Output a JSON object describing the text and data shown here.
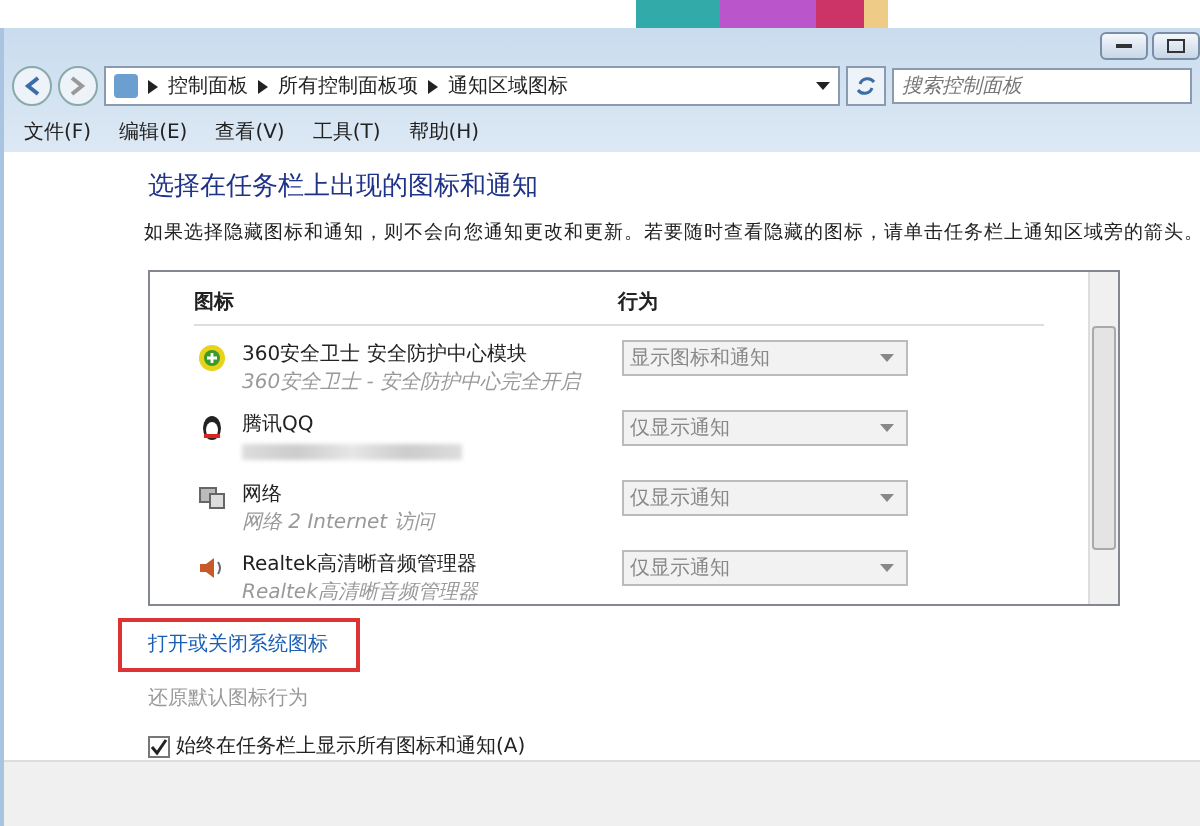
{
  "address_bar": {
    "breadcrumb": [
      "控制面板",
      "所有控制面板项",
      "通知区域图标"
    ],
    "search": {
      "placeholder": "搜索控制面板"
    }
  },
  "menu_bar": [
    "文件(F)",
    "编辑(E)",
    "查看(V)",
    "工具(T)",
    "帮助(H)"
  ],
  "heading": "选择在任务栏上出现的图标和通知",
  "description": "如果选择隐藏图标和通知，则不会向您通知更改和更新。若要随时查看隐藏的图标，请单击任务栏上通知区域旁的箭头。",
  "table": {
    "columns": [
      "图标",
      "行为"
    ],
    "rows": [
      {
        "kind": "shield",
        "name": "360安全卫士 安全防护中心模块",
        "detail": "360安全卫士 - 安全防护中心完全开启",
        "redacted": false,
        "behavior": "显示图标和通知",
        "disabled": true
      },
      {
        "kind": "penguin",
        "name": "腾讯QQ",
        "redacted": true,
        "behavior": "仅显示通知",
        "disabled": true
      },
      {
        "kind": "network",
        "name": "网络",
        "detail": "网络 2 Internet 访问",
        "redacted": false,
        "behavior": "仅显示通知",
        "disabled": true
      },
      {
        "kind": "speaker",
        "name": "Realtek高清晰音频管理器",
        "detail": "Realtek高清晰音频管理器",
        "redacted": false,
        "behavior": "仅显示通知",
        "disabled": true
      }
    ]
  },
  "links": [
    {
      "label": "打开或关闭系统图标",
      "disabled": false,
      "highlighted": true
    },
    {
      "label": "还原默认图标行为",
      "disabled": true,
      "highlighted": false
    }
  ],
  "always_show": {
    "label": "始终在任务栏上显示所有图标和通知(A)",
    "checked": true
  }
}
